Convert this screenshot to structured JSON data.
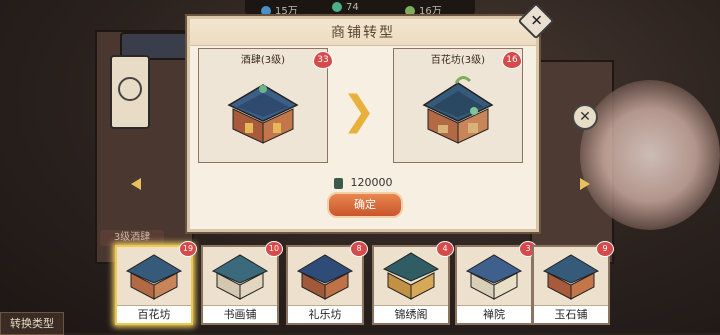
{
  "resources": [
    {
      "icon": "water-drop-icon",
      "value": "15万",
      "color": "#4a90c8"
    },
    {
      "icon": "jade-coin-icon",
      "value": "74",
      "color": "#4caf8a"
    },
    {
      "icon": "leaf-icon",
      "value": "16万",
      "color": "#7fae5a"
    }
  ],
  "dialog": {
    "title": "商铺转型",
    "from": {
      "label": "酒肆(3级)",
      "badge": "33"
    },
    "to": {
      "label": "百花坊(3级)",
      "badge": "16"
    },
    "price": "120000",
    "confirm_label": "确定"
  },
  "background": {
    "shop_tag": "3级酒肆"
  },
  "shops": [
    {
      "label": "百花坊",
      "badge": "19",
      "selected": true
    },
    {
      "label": "书画铺",
      "badge": "10"
    },
    {
      "label": "礼乐坊",
      "badge": "8"
    },
    {
      "label": "锦绣阁",
      "badge": "4"
    },
    {
      "label": "禅院",
      "badge": "3"
    },
    {
      "label": "玉石铺",
      "badge": "9"
    }
  ],
  "type_label": "转换类型",
  "colors": {
    "accent": "#e8874f",
    "badge": "#d54a4a",
    "selected": "#f0c84a"
  }
}
